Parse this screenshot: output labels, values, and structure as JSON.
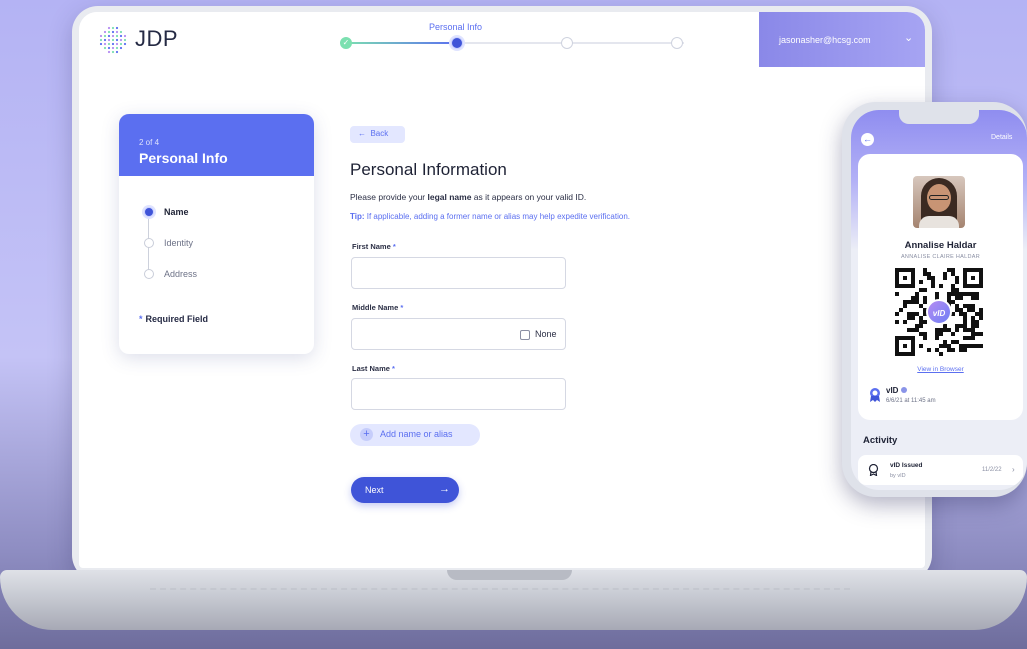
{
  "header": {
    "logo_text": "JDP",
    "progress_label": "Personal Info",
    "progress_check": "✓",
    "user_email": "jasonasher@hcsg.com",
    "user_chevron": "⌄"
  },
  "sidebar": {
    "step_count": "2 of 4",
    "title": "Personal Info",
    "items": [
      {
        "label": "Name",
        "active": true
      },
      {
        "label": "Identity",
        "active": false
      },
      {
        "label": "Address",
        "active": false
      }
    ],
    "required_star": "*",
    "required_label": "Required Field"
  },
  "form": {
    "back_label": "Back",
    "back_arrow": "←",
    "title": "Personal Information",
    "desc_pre": "Please provide your ",
    "desc_bold": "legal name",
    "desc_post": " as it appears on your valid ID.",
    "tip_bold": "Tip:",
    "tip_text": " If applicable, adding a former name or alias may help expedite verification.",
    "first_name_label": "First Name",
    "middle_name_label": "Middle Name",
    "last_name_label": "Last Name",
    "required_star": "*",
    "none_label": "None",
    "add_alias_label": "Add name or alias",
    "add_alias_icon": "+",
    "next_label": "Next",
    "next_arrow": "→",
    "first_name_value": "",
    "middle_name_value": "",
    "last_name_value": ""
  },
  "phone": {
    "back_icon": "←",
    "details_label": "Details",
    "name": "Annalise Haldar",
    "legal_name": "ANNALISE CLAIRE HALDAR",
    "qr_logo": "vID",
    "view_browser_label": "View in Browser",
    "vid_title": "vID",
    "vid_date": "6/6/21 at 11:45 am",
    "activity_title": "Activity",
    "activity_item_title": "vID Issued",
    "activity_item_sub": "by vID",
    "activity_item_date": "11/2/22",
    "activity_item_chevron": "›"
  },
  "colors": {
    "accent": "#5b6ff0",
    "accent_dark": "#3f54d8",
    "success": "#7ce0b0",
    "background": "#b4b3f4"
  },
  "icons": [
    "jdp-logo-icon",
    "check-icon",
    "chevron-down-icon",
    "arrow-left-icon",
    "plus-icon",
    "arrow-right-icon",
    "award-badge-icon",
    "certificate-icon",
    "chevron-right-icon"
  ]
}
